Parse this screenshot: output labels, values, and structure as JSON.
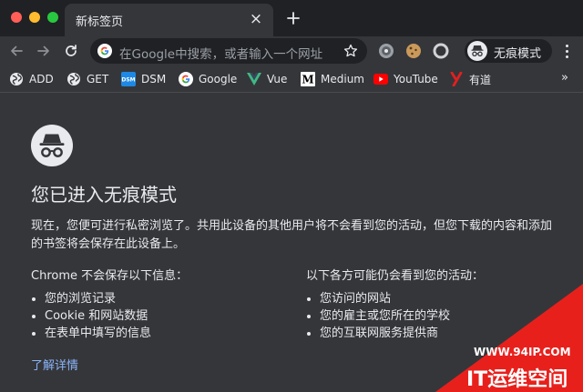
{
  "window": {
    "traffic_colors": [
      "#ff5f57",
      "#febc2e",
      "#28c840"
    ]
  },
  "tab": {
    "title": "新标签页",
    "close": "×"
  },
  "omnibox": {
    "placeholder": "在Google中搜索，或者输入一个网址"
  },
  "toolbar": {
    "incognito_label": "无痕模式"
  },
  "bookmarks": [
    {
      "label": "ADD",
      "icon": "globe-icon"
    },
    {
      "label": "GET",
      "icon": "globe-icon"
    },
    {
      "label": "DSM",
      "icon": "dsm-icon"
    },
    {
      "label": "Google",
      "icon": "google-icon"
    },
    {
      "label": "Vue",
      "icon": "vue-icon"
    },
    {
      "label": "Medium",
      "icon": "medium-icon"
    },
    {
      "label": "YouTube",
      "icon": "youtube-icon"
    },
    {
      "label": "有道",
      "icon": "youdao-icon"
    }
  ],
  "bookmarks_more": "»",
  "main": {
    "title": "您已进入无痕模式",
    "description": "现在，您便可进行私密浏览了。共用此设备的其他用户将不会看到您的活动，但您下载的内容和添加的书签将会保存在此设备上。",
    "not_saved": {
      "heading": "Chrome 不会保存以下信息：",
      "items": [
        "您的浏览记录",
        "Cookie 和网站数据",
        "在表单中填写的信息"
      ]
    },
    "visible_to": {
      "heading": "以下各方可能仍会看到您的活动：",
      "items": [
        "您访问的网站",
        "您的雇主或您所在的学校",
        "您的互联网服务提供商"
      ]
    },
    "learn_more": "了解详情"
  },
  "watermark": {
    "url": "WWW.94IP.COM",
    "name": "IT运维空间"
  },
  "colors": {
    "tabstrip": "#202124",
    "page": "#35363a",
    "text": "#e8eaed",
    "link": "#8ab4f8",
    "watermark": "#e8201c"
  }
}
